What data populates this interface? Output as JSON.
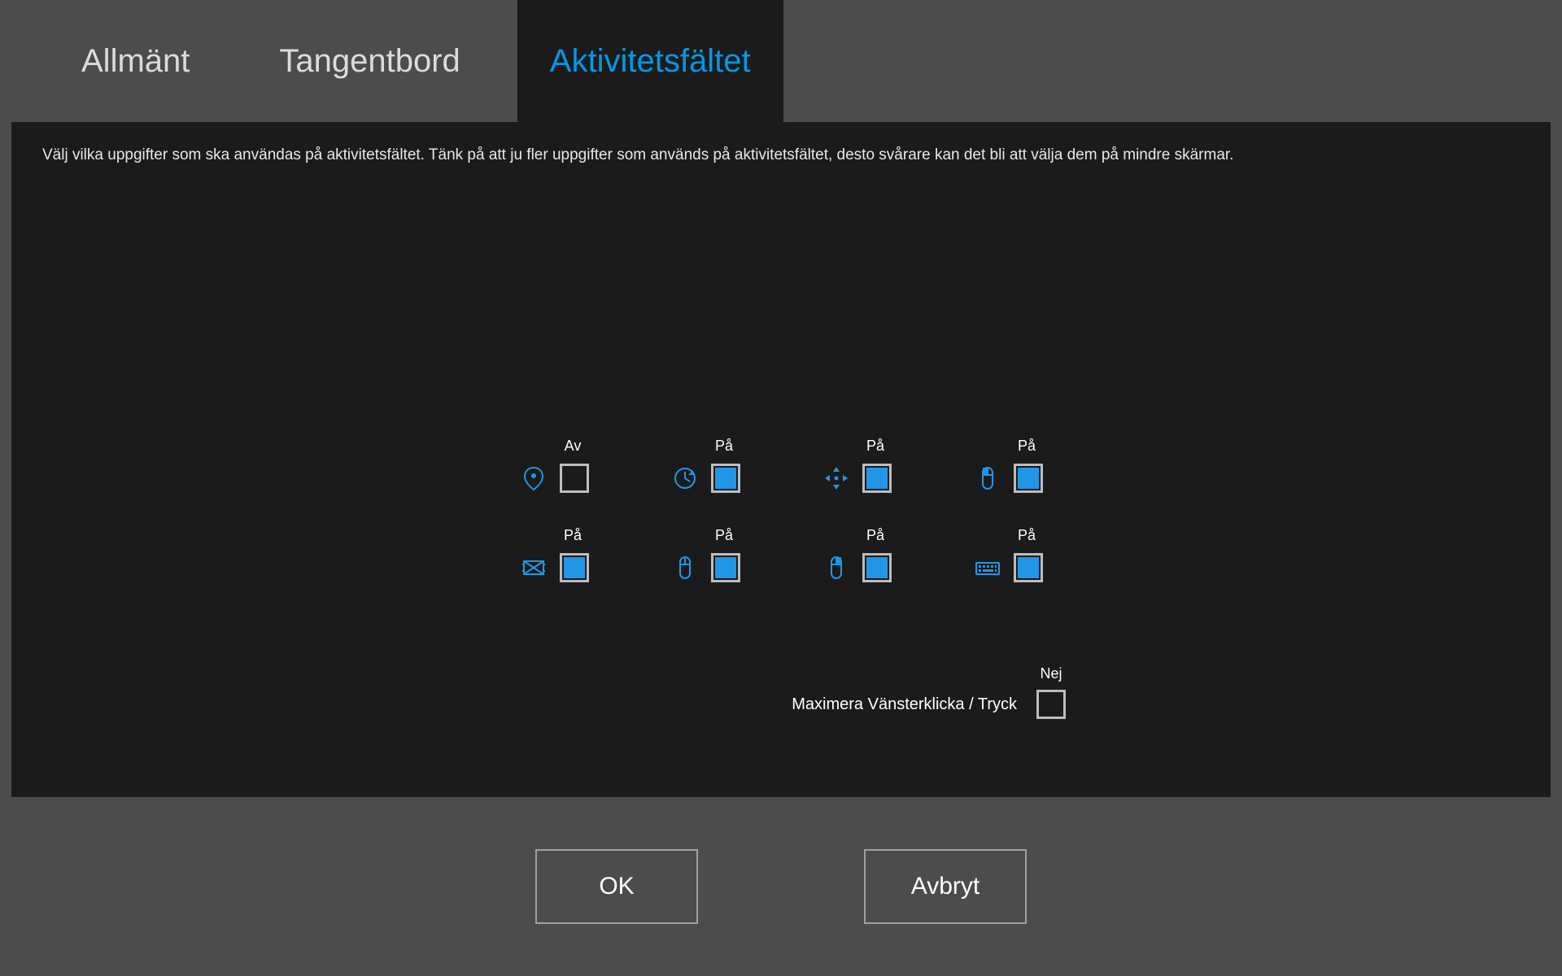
{
  "tabs": {
    "general": "Allmänt",
    "keyboard": "Tangentbord",
    "taskbar": "Aktivitetsfältet"
  },
  "description": "Välj vilka uppgifter som ska användas på aktivitetsfältet. Tänk på att ju fler uppgifter som används på aktivitetsfältet, desto svårare kan det bli att välja dem på mindre skärmar.",
  "labels": {
    "on": "På",
    "off": "Av",
    "no": "Nej"
  },
  "toggles": [
    {
      "icon": "location-icon",
      "state_key": "off",
      "checked": false
    },
    {
      "icon": "refresh-icon",
      "state_key": "on",
      "checked": true
    },
    {
      "icon": "move-icon",
      "state_key": "on",
      "checked": true
    },
    {
      "icon": "mouse-left-icon",
      "state_key": "on",
      "checked": true
    },
    {
      "icon": "calibrate-icon",
      "state_key": "on",
      "checked": true
    },
    {
      "icon": "mouse-icon",
      "state_key": "on",
      "checked": true
    },
    {
      "icon": "mouse-right-icon",
      "state_key": "on",
      "checked": true
    },
    {
      "icon": "keyboard-icon",
      "state_key": "on",
      "checked": true
    }
  ],
  "maximize": {
    "label": "Maximera Vänsterklicka / Tryck",
    "state_key": "no",
    "checked": false
  },
  "buttons": {
    "ok": "OK",
    "cancel": "Avbryt"
  },
  "accent": "#2196e6"
}
